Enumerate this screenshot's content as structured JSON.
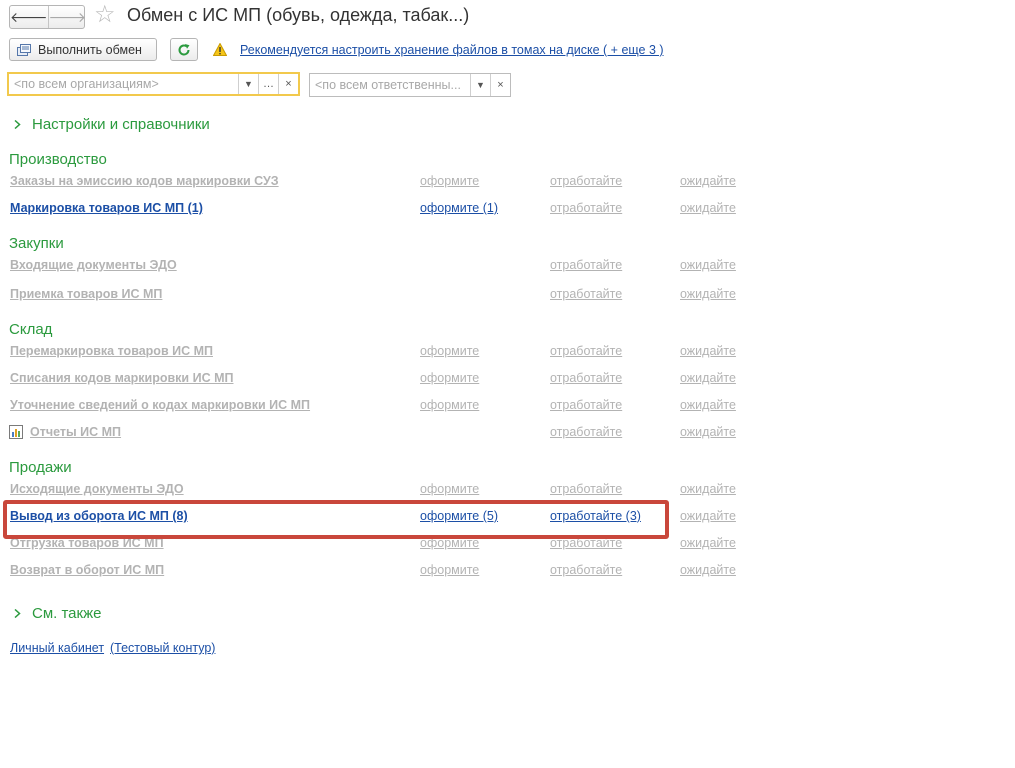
{
  "window": {
    "title": "Обмен с ИС МП (обувь, одежда, табак...)",
    "back_icon": "arrow-left",
    "forward_icon": "arrow-right",
    "favorite_icon": "star-outline"
  },
  "toolbar": {
    "exchange_label": "Выполнить обмен",
    "warning_text": "Рекомендуется настроить хранение файлов в томах на диске ( + еще 3 )"
  },
  "filters": {
    "org_placeholder": "<по всем организациям>",
    "resp_placeholder": "<по всем ответственны..."
  },
  "sections": {
    "settings_label": "Настройки и справочники",
    "see_also_label": "См. также"
  },
  "groups": {
    "production": "Производство",
    "purchases": "Закупки",
    "warehouse": "Склад",
    "sales": "Продажи"
  },
  "rows": [
    {
      "label": "Заказы на эмиссию кодов маркировки СУЗ",
      "c1": "оформите",
      "c2": "отработайте",
      "c3": "ожидайте"
    },
    {
      "label": "Маркировка товаров ИС МП (1)",
      "c1": "оформите (1)",
      "c2": "отработайте",
      "c3": "ожидайте"
    },
    {
      "label": "Входящие документы ЭДО",
      "c1": "",
      "c2": "отработайте",
      "c3": "ожидайте"
    },
    {
      "label": "Приемка товаров ИС МП",
      "c1": "",
      "c2": "отработайте",
      "c3": "ожидайте"
    },
    {
      "label": "Перемаркировка товаров ИС МП",
      "c1": "оформите",
      "c2": "отработайте",
      "c3": "ожидайте"
    },
    {
      "label": "Списания кодов маркировки ИС МП",
      "c1": "оформите",
      "c2": "отработайте",
      "c3": "ожидайте"
    },
    {
      "label": "Уточнение сведений о кодах маркировки ИС МП",
      "c1": "оформите",
      "c2": "отработайте",
      "c3": "ожидайте"
    },
    {
      "label": "Отчеты ИС МП",
      "c1": "",
      "c2": "отработайте",
      "c3": "ожидайте"
    },
    {
      "label": "Исходящие документы ЭДО",
      "c1": "оформите",
      "c2": "отработайте",
      "c3": "ожидайте"
    },
    {
      "label": "Вывод из оборота ИС МП (8)",
      "c1": "оформите (5)",
      "c2": "отработайте (3)",
      "c3": "ожидайте"
    },
    {
      "label": "Отгрузка товаров ИС МП",
      "c1": "оформите",
      "c2": "отработайте",
      "c3": "ожидайте"
    },
    {
      "label": "Возврат в оборот ИС МП",
      "c1": "оформите",
      "c2": "отработайте",
      "c3": "ожидайте"
    }
  ],
  "footer": {
    "cabinet_label": "Личный кабинет",
    "test_label": "(Тестовый контур)"
  },
  "colors": {
    "accent_green": "#2b9a3e",
    "link_blue": "#1c4fa6",
    "disabled_gray": "#b3b3b3",
    "highlight_red": "#c9473b",
    "focus_yellow": "#f2c94c"
  }
}
